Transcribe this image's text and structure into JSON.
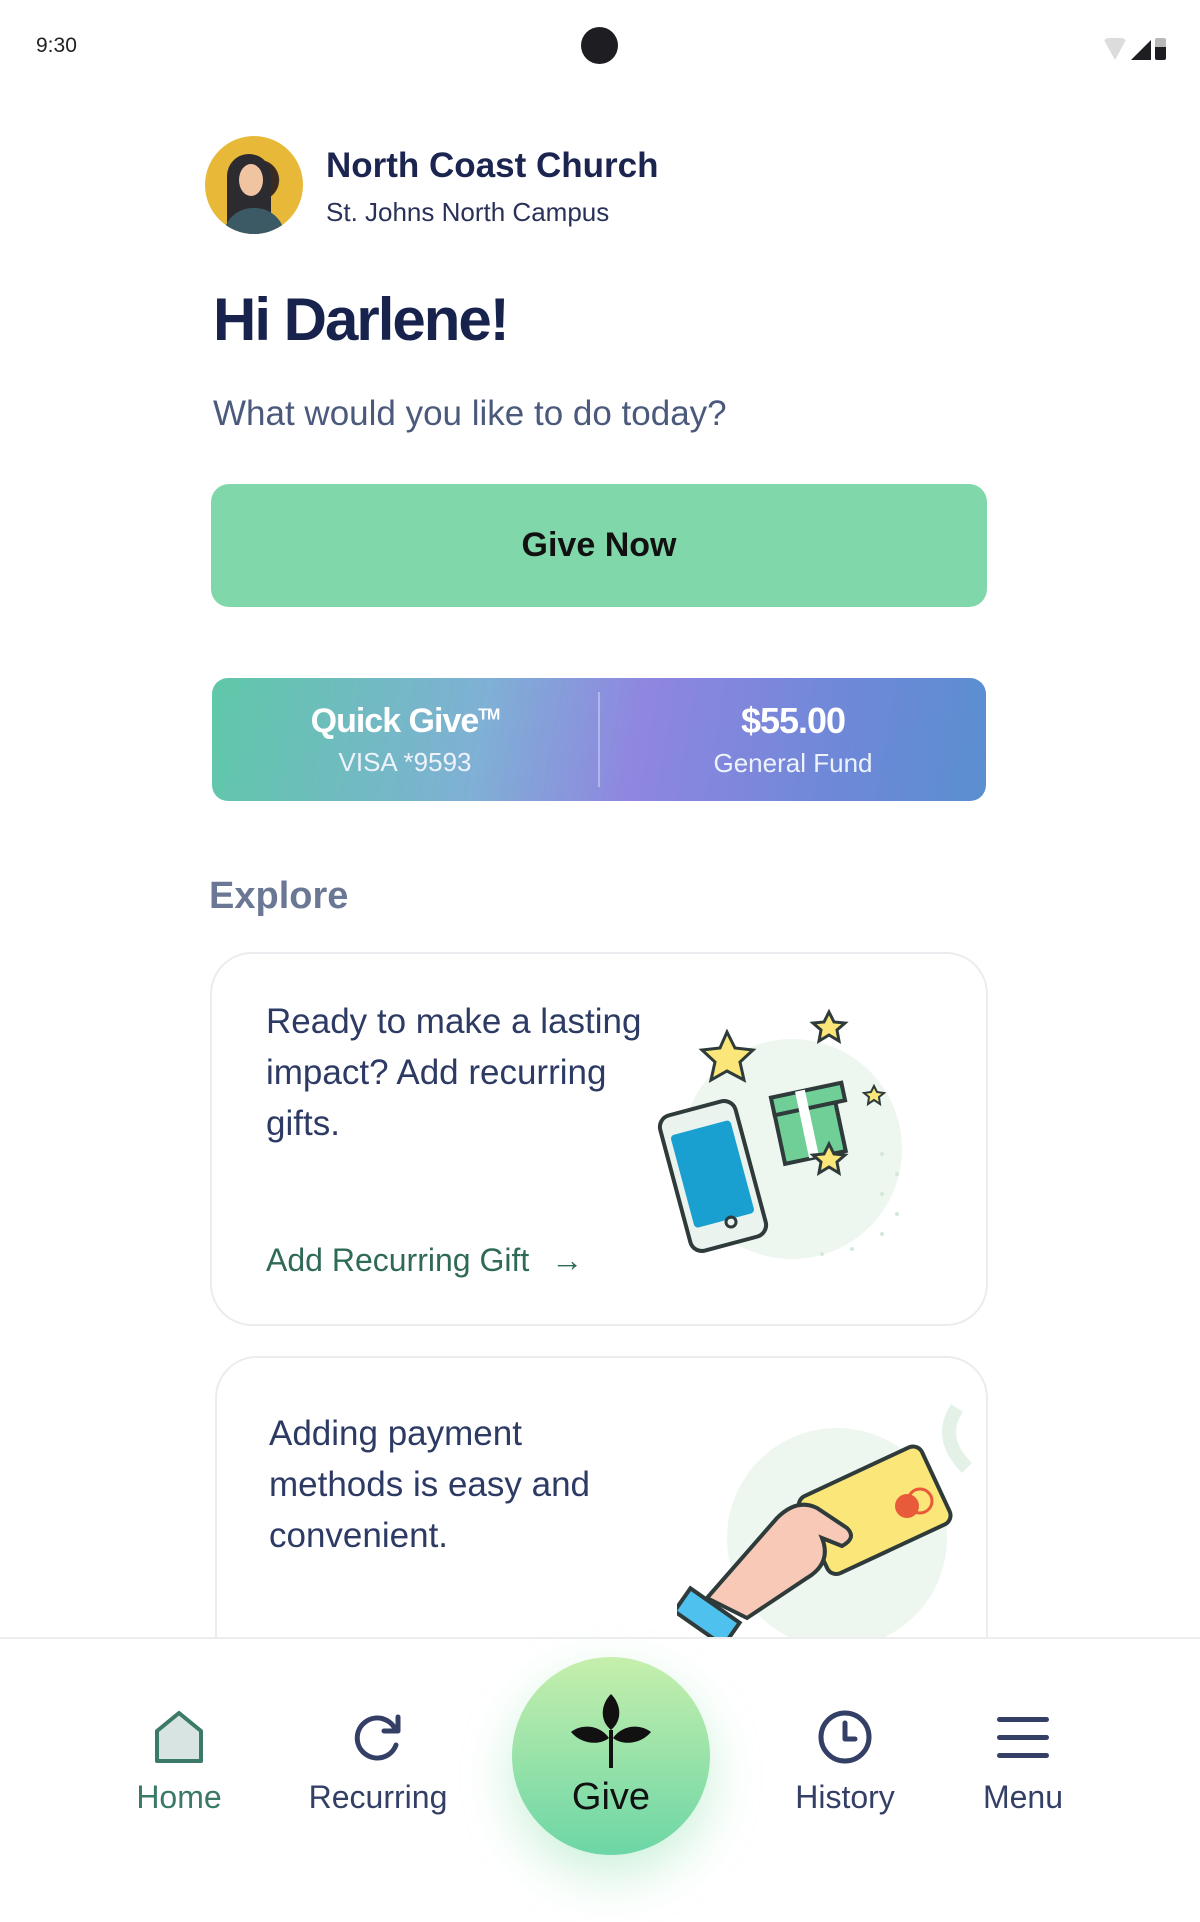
{
  "status_bar": {
    "time": "9:30",
    "icons": [
      "wifi-icon",
      "signal-icon",
      "battery-icon"
    ]
  },
  "header": {
    "org_name": "North Coast Church",
    "campus": "St. Johns North Campus"
  },
  "greeting": {
    "title": "Hi Darlene!",
    "subtitle": "What would you like to do today?"
  },
  "actions": {
    "give_now_label": "Give Now"
  },
  "quick_give": {
    "title": "Quick Give",
    "trademark": "TM",
    "payment_method": "VISA *9593",
    "amount": "$55.00",
    "fund": "General Fund"
  },
  "explore": {
    "title": "Explore",
    "cards": [
      {
        "text": "Ready to make a lasting impact? Add recurring gifts.",
        "link_label": "Add Recurring Gift",
        "illustration": "phone-gift-illustration"
      },
      {
        "text": "Adding payment methods is easy and convenient.",
        "illustration": "hand-card-illustration"
      }
    ]
  },
  "nav": {
    "items": [
      {
        "label": "Home",
        "icon": "home-icon",
        "active": true
      },
      {
        "label": "Recurring",
        "icon": "recurring-icon",
        "active": false
      },
      {
        "label": "Give",
        "icon": "sprout-icon",
        "active": false
      },
      {
        "label": "History",
        "icon": "clock-icon",
        "active": false
      },
      {
        "label": "Menu",
        "icon": "menu-icon",
        "active": false
      }
    ]
  },
  "colors": {
    "primary_green": "#80d7a9",
    "navy": "#1c2550",
    "link_green": "#2f6a56"
  }
}
